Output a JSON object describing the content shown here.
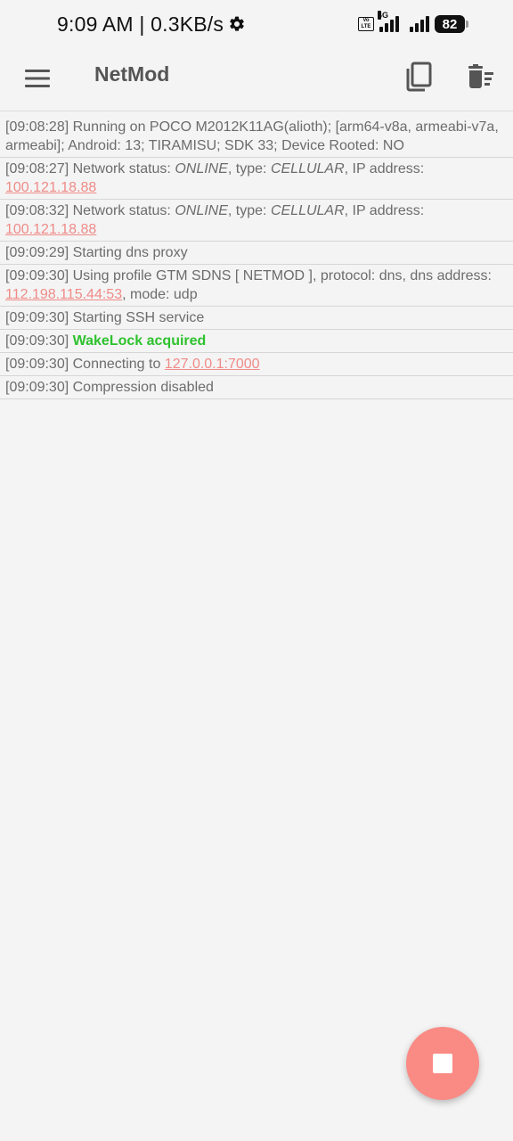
{
  "status_bar": {
    "time_speed": "9:09 AM | 0.3KB/s",
    "volte_label": "Vo\nLTE",
    "network_type": "4G",
    "battery": "82"
  },
  "app_bar": {
    "title": "NetMod"
  },
  "log": [
    {
      "parts": [
        {
          "text": "[09:08:28] Running on POCO M2012K11AG(alioth); [arm64-v8a, armeabi-v7a, armeabi]; Android: 13; TIRAMISU; SDK 33; Device Rooted: NO",
          "style": "normal"
        }
      ]
    },
    {
      "parts": [
        {
          "text": "[09:08:27] Network status: ",
          "style": "normal"
        },
        {
          "text": "ONLINE",
          "style": "italic"
        },
        {
          "text": ", type: ",
          "style": "normal"
        },
        {
          "text": "CELLULAR",
          "style": "italic"
        },
        {
          "text": ", IP address: ",
          "style": "normal"
        },
        {
          "text": "100.121.18.88",
          "style": "link"
        }
      ]
    },
    {
      "parts": [
        {
          "text": "[09:08:32] Network status: ",
          "style": "normal"
        },
        {
          "text": "ONLINE",
          "style": "italic"
        },
        {
          "text": ", type: ",
          "style": "normal"
        },
        {
          "text": "CELLULAR",
          "style": "italic"
        },
        {
          "text": ", IP address: ",
          "style": "normal"
        },
        {
          "text": "100.121.18.88",
          "style": "link"
        }
      ]
    },
    {
      "parts": [
        {
          "text": "[09:09:29] Starting dns proxy",
          "style": "normal"
        }
      ]
    },
    {
      "parts": [
        {
          "text": "[09:09:30] Using profile GTM SDNS [ NETMOD ], protocol: dns, dns address: ",
          "style": "normal"
        },
        {
          "text": "112.198.115.44:53",
          "style": "link"
        },
        {
          "text": ", mode: udp",
          "style": "normal"
        }
      ]
    },
    {
      "parts": [
        {
          "text": "[09:09:30] Starting SSH service",
          "style": "normal"
        }
      ]
    },
    {
      "parts": [
        {
          "text": "[09:09:30] ",
          "style": "normal"
        },
        {
          "text": "WakeLock acquired",
          "style": "green"
        }
      ]
    },
    {
      "parts": [
        {
          "text": "[09:09:30] Connecting to ",
          "style": "normal"
        },
        {
          "text": "127.0.0.1:7000",
          "style": "link"
        }
      ]
    },
    {
      "parts": [
        {
          "text": "[09:09:30] Compression disabled",
          "style": "normal"
        }
      ]
    }
  ],
  "icons": {
    "menu": "menu-icon",
    "copy": "copy-icon",
    "clear": "delete-sweep-icon",
    "fab": "stop-icon",
    "settings": "gear-icon"
  },
  "colors": {
    "link": "#ef8b88",
    "success": "#2ec22e",
    "fab": "#fa8a84",
    "background": "#f4f4f4"
  }
}
